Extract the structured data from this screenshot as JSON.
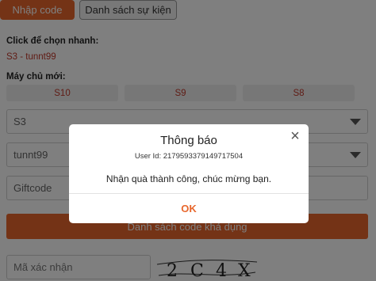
{
  "tabs": {
    "redeem_code": "Nhập code",
    "event_list": "Danh sách sự kiện"
  },
  "quick_select": {
    "label": "Click để chọn nhanh:",
    "value": "S3 - tunnt99"
  },
  "new_servers": {
    "label": "Máy chủ mới:",
    "buttons": [
      "S10",
      "S9",
      "S8"
    ]
  },
  "form": {
    "server_value": "S3",
    "character_value": "tunnt99",
    "giftcode_placeholder": "Giftcode",
    "code_list_button": "Danh sách code khả dụng",
    "captcha_placeholder": "Mã xác nhận",
    "captcha_text": "2C4X"
  },
  "colors": {
    "accent": "#e8672d",
    "server_text": "#c0392b"
  },
  "modal": {
    "title": "Thông báo",
    "user_id": "User Id: 2179593379149717504",
    "message": "Nhận quà thành công, chúc mừng bạn.",
    "ok_label": "OK",
    "close_icon": "close-icon"
  }
}
